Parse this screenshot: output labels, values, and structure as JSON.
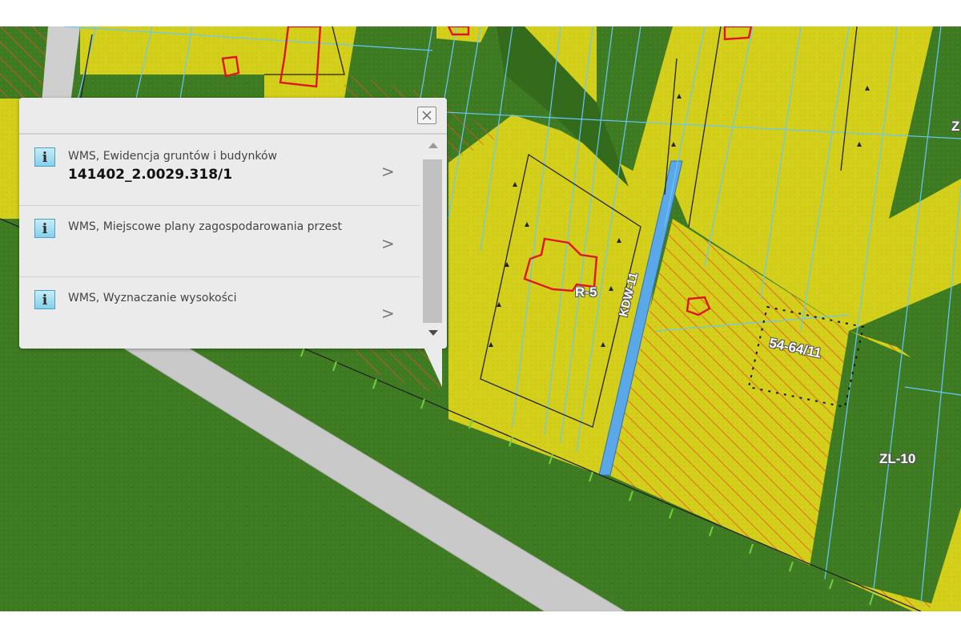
{
  "popup": {
    "close_icon": "close-x-icon",
    "items": [
      {
        "icon": "info-icon",
        "icon_text": "i",
        "title": "WMS, Ewidencja gruntów i budynków",
        "value": "141402_2.0029.318/1",
        "chevron": ">"
      },
      {
        "icon": "info-icon",
        "icon_text": "i",
        "title": "WMS, Miejscowe plany zagospodarowania przest",
        "value": "",
        "chevron": ">"
      },
      {
        "icon": "info-icon",
        "icon_text": "i",
        "title": "WMS, Wyznaczanie wysokości",
        "value": "",
        "chevron": ">"
      }
    ]
  },
  "map": {
    "labels": {
      "zone_r5": "R-5",
      "road_kdw": "KDW-11",
      "parcel_54": "54-64/11",
      "zone_zl10": "ZL-10",
      "edge_z": "Z"
    },
    "colors": {
      "forest": "#3f7a22",
      "agricultural": "#d6d21a",
      "hatch": "#e8502a",
      "boundary": "#66c8ff",
      "building": "#e0141e",
      "road": "#5aa8e8",
      "path": "#c8c8c8"
    }
  }
}
